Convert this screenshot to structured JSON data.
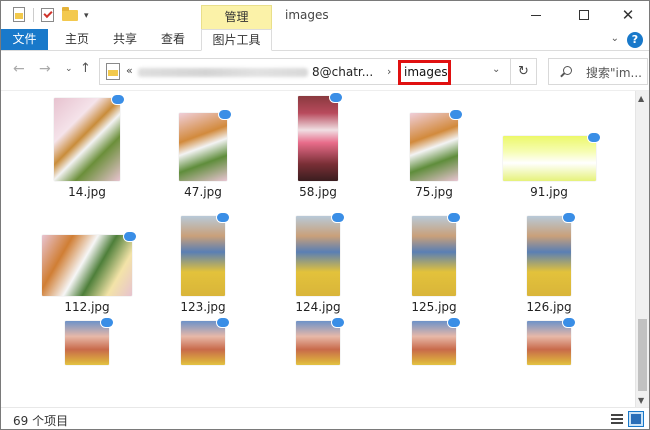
{
  "window": {
    "title": "images",
    "context_tab": "管理",
    "controls": {
      "minimize": "—",
      "maximize": "□",
      "close": "✕"
    }
  },
  "ribbon": {
    "tabs": [
      "文件",
      "主页",
      "共享",
      "查看",
      "图片工具"
    ],
    "help": "?"
  },
  "address": {
    "prefix": "«",
    "path_tail": "8@chatr...",
    "separator": "›",
    "current": "images",
    "refresh_icon": "refresh-icon"
  },
  "search": {
    "placeholder": "搜索\"im..."
  },
  "files": [
    {
      "name": "14.jpg",
      "kind": "food"
    },
    {
      "name": "47.jpg",
      "kind": "food-tall"
    },
    {
      "name": "58.jpg",
      "kind": "screen"
    },
    {
      "name": "75.jpg",
      "kind": "food-tall"
    },
    {
      "name": "91.jpg",
      "kind": "table"
    },
    {
      "name": "112.jpg",
      "kind": "food-wide"
    },
    {
      "name": "123.jpg",
      "kind": "child"
    },
    {
      "name": "124.jpg",
      "kind": "child"
    },
    {
      "name": "125.jpg",
      "kind": "child"
    },
    {
      "name": "126.jpg",
      "kind": "child"
    },
    {
      "name": "",
      "kind": "child-partial"
    },
    {
      "name": "",
      "kind": "child-partial"
    },
    {
      "name": "",
      "kind": "child-partial"
    },
    {
      "name": "",
      "kind": "child-partial"
    },
    {
      "name": "",
      "kind": "child-partial"
    }
  ],
  "status": {
    "item_count": "69 个项目"
  },
  "colors": {
    "accent": "#1979ca",
    "highlight_box": "#e01010",
    "context_tab_bg": "#fbf2a8"
  }
}
